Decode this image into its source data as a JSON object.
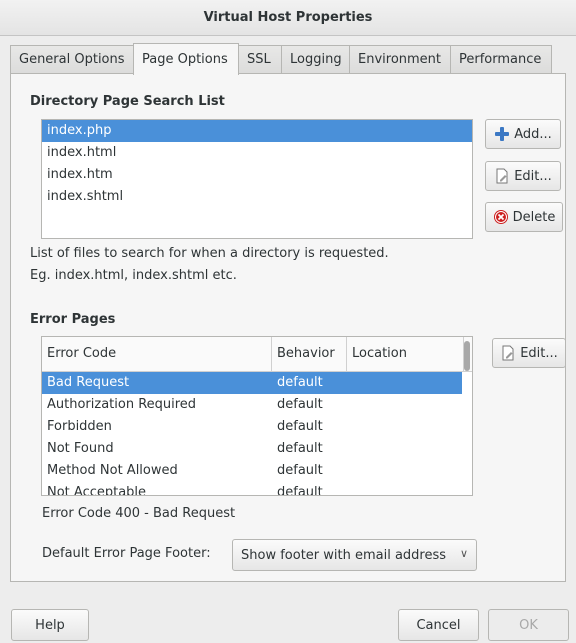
{
  "window": {
    "title": "Virtual Host Properties"
  },
  "tabs": [
    {
      "label": "General Options"
    },
    {
      "label": "Page Options"
    },
    {
      "label": "SSL"
    },
    {
      "label": "Logging"
    },
    {
      "label": "Environment"
    },
    {
      "label": "Performance"
    }
  ],
  "directory": {
    "title": "Directory Page Search List",
    "items": [
      "index.php",
      "index.html",
      "index.htm",
      "index.shtml"
    ],
    "selected": "index.php",
    "add_label": "Add...",
    "edit_label": "Edit...",
    "delete_label": "Delete",
    "help_line1": "List of files to search for when a directory is requested.",
    "help_line2": "Eg. index.html, index.shtml etc."
  },
  "error_pages": {
    "title": "Error Pages",
    "columns": [
      "Error Code",
      "Behavior",
      "Location"
    ],
    "rows": [
      {
        "code": "Bad Request",
        "behavior": "default",
        "location": ""
      },
      {
        "code": "Authorization Required",
        "behavior": "default",
        "location": ""
      },
      {
        "code": "Forbidden",
        "behavior": "default",
        "location": ""
      },
      {
        "code": "Not Found",
        "behavior": "default",
        "location": ""
      },
      {
        "code": "Method Not Allowed",
        "behavior": "default",
        "location": ""
      },
      {
        "code": "Not Acceptable",
        "behavior": "default",
        "location": ""
      }
    ],
    "selected": "Bad Request",
    "edit_label": "Edit...",
    "status": "Error Code 400 - Bad Request",
    "footer_label": "Default Error Page Footer:",
    "footer_value": "Show footer with email address"
  },
  "footer_buttons": {
    "help": "Help",
    "cancel": "Cancel",
    "ok": "OK"
  },
  "colors": {
    "selection": "#4a90d9",
    "add_icon": "#3b78c4",
    "delete_icon": "#cc1f1f"
  },
  "icons": [
    "plus-icon",
    "document-edit-icon",
    "delete-icon",
    "chevron-down-icon"
  ]
}
